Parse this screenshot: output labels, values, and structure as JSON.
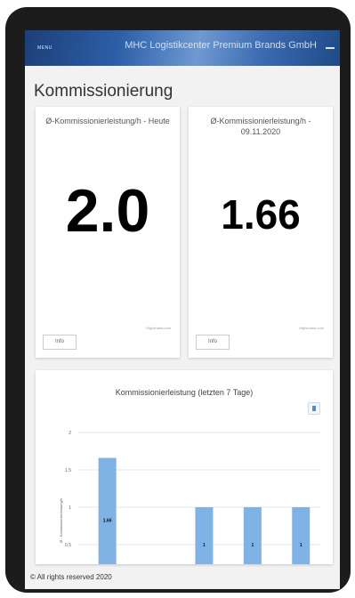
{
  "header": {
    "menu_label": "MENU",
    "company": "MHC Logistikcenter Premium Brands GmbH"
  },
  "page_title": "Kommissionierung",
  "kpis": [
    {
      "label": "Ø-Kommissionierleistung/h - Heute",
      "value": "2.0",
      "button_label": "Info",
      "credit": "Highcharts.com"
    },
    {
      "label": "Ø-Kommissionierleistung/h - 09.11.2020",
      "value": "1.66",
      "button_label": "Info",
      "credit": "Highcharts.com"
    }
  ],
  "chart_data": {
    "type": "bar",
    "title": "Kommissionierleistung (letzten 7 Tage)",
    "ylabel": "Ø - Kommissionierleistung/h",
    "ylim": [
      0,
      2
    ],
    "yticks": [
      "2",
      "1.5",
      "1",
      "0.5"
    ],
    "values": [
      1.66,
      null,
      1,
      1,
      1
    ],
    "data_labels": [
      "1.66",
      "",
      "1",
      "1",
      "1"
    ],
    "bar_color": "#7fb2e5"
  },
  "footer": "© All rights reserved 2020"
}
